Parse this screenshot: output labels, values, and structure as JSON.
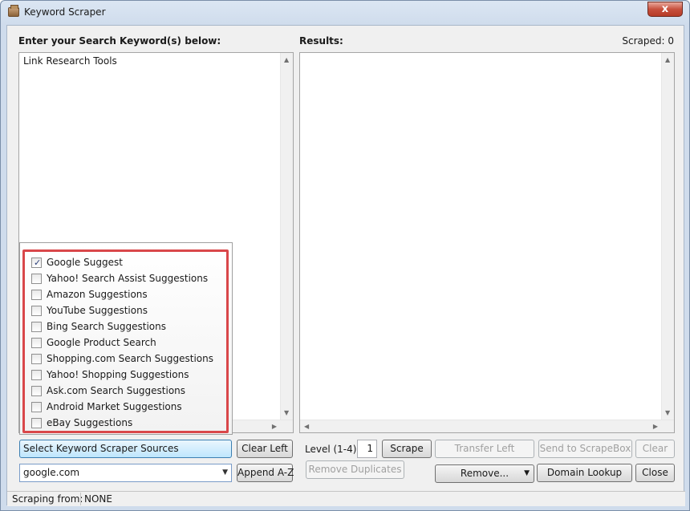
{
  "window": {
    "title": "Keyword Scraper",
    "close_glyph": "x"
  },
  "left": {
    "heading": "Enter your Search Keyword(s) below:",
    "keywords_text": "Link Research Tools"
  },
  "right": {
    "heading": "Results:",
    "scraped_label": "Scraped: 0"
  },
  "sources": [
    {
      "label": "Google Suggest",
      "checked": true
    },
    {
      "label": "Yahoo! Search Assist Suggestions",
      "checked": false
    },
    {
      "label": "Amazon Suggestions",
      "checked": false
    },
    {
      "label": "YouTube Suggestions",
      "checked": false
    },
    {
      "label": "Bing Search Suggestions",
      "checked": false
    },
    {
      "label": "Google Product Search",
      "checked": false
    },
    {
      "label": "Shopping.com Search Suggestions",
      "checked": false
    },
    {
      "label": "Yahoo! Shopping Suggestions",
      "checked": false
    },
    {
      "label": "Ask.com Search Suggestions",
      "checked": false
    },
    {
      "label": "Android Market Suggestions",
      "checked": false
    },
    {
      "label": "eBay Suggestions",
      "checked": false
    }
  ],
  "controls": {
    "select_sources": "Select Keyword Scraper Sources",
    "clear_left": "Clear Left",
    "engine_value": "google.com",
    "append_az": "Append A-Z",
    "level_label": "Level (1-4):",
    "level_value": "1",
    "scrape": "Scrape",
    "transfer_left": "Transfer Left",
    "send_to_scrapebox": "Send to ScrapeBox",
    "clear": "Clear",
    "remove_duplicates": "Remove Duplicates",
    "remove": "Remove...",
    "domain_lookup": "Domain Lookup",
    "close": "Close"
  },
  "status": {
    "label": "Scraping from:",
    "value": "NONE"
  },
  "colors": {
    "highlight_border": "#d9474a",
    "accent_blue": "#7a9cc8"
  }
}
